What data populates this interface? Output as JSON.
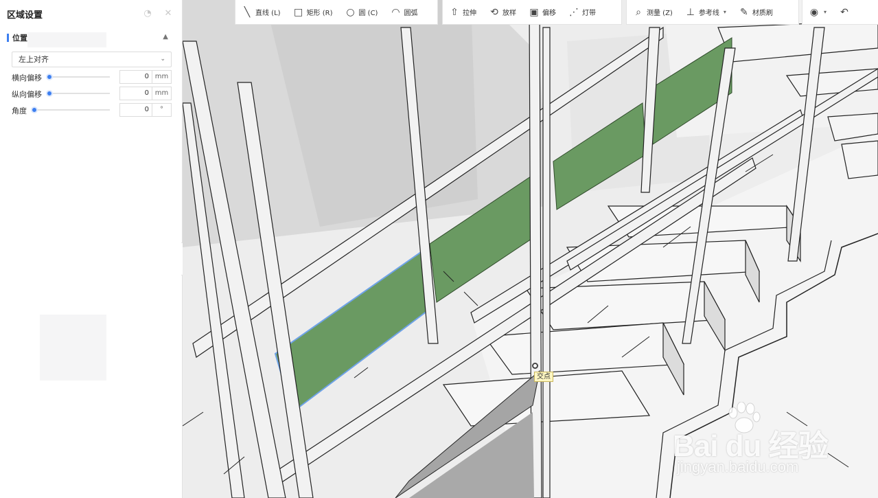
{
  "panel": {
    "title": "区域设置",
    "section": "位置",
    "align_select": "左上对齐",
    "rows": [
      {
        "label": "横向偏移",
        "value": "0",
        "unit": "mm"
      },
      {
        "label": "纵向偏移",
        "value": "0",
        "unit": "mm"
      },
      {
        "label": "角度",
        "value": "0",
        "unit": "°"
      }
    ]
  },
  "toolbar": {
    "draw": [
      {
        "label": "直线 (L)",
        "icon": "line-icon"
      },
      {
        "label": "矩形 (R)",
        "icon": "rectangle-icon"
      },
      {
        "label": "圆 (C)",
        "icon": "circle-icon"
      },
      {
        "label": "圆弧",
        "icon": "arc-icon"
      }
    ],
    "edit": [
      {
        "label": "拉伸",
        "icon": "extrude-icon"
      },
      {
        "label": "放样",
        "icon": "loft-icon"
      },
      {
        "label": "偏移",
        "icon": "offset-icon"
      },
      {
        "label": "灯带",
        "icon": "light-strip-icon"
      }
    ],
    "misc": [
      {
        "label": "测量 (Z)",
        "icon": "measure-icon"
      },
      {
        "label": "参考线",
        "icon": "reference-line-icon"
      },
      {
        "label": "材质刷",
        "icon": "material-brush-icon"
      }
    ]
  },
  "viewport": {
    "snap_tooltip": "交点"
  },
  "watermark": {
    "brand": "Bai du 经验",
    "url": "jingyan.baidu.com"
  },
  "colors": {
    "accent": "#3d7ff0",
    "panel_fill": "#6a9a62",
    "selection_outline": "#6fa3e8"
  }
}
